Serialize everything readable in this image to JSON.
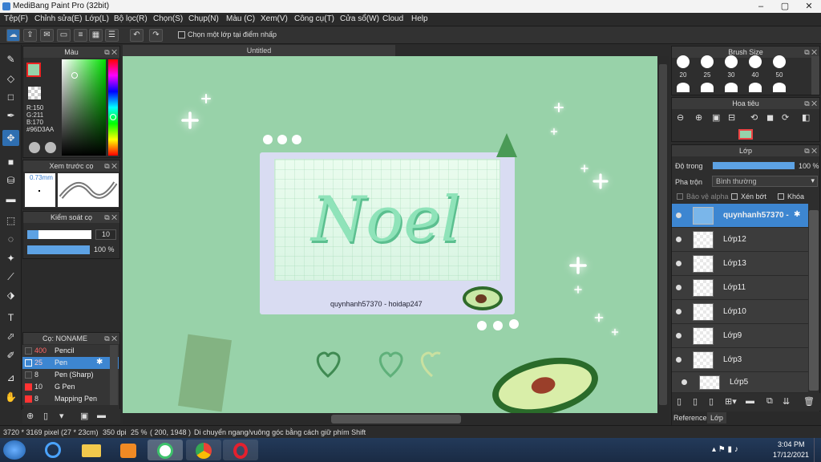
{
  "app": {
    "title": "MediBang Paint Pro (32bit)"
  },
  "menu": [
    "Tệp(F)",
    "Chỉnh sửa(E)",
    "Lớp(L)",
    "Bộ lọc(R)",
    "Chọn(S)",
    "Chụp(N)",
    "Màu (C)",
    "Xem(V)",
    "Công cụ(T)",
    "Cửa sổ(W)",
    "Cloud",
    "Help"
  ],
  "toolbar": {
    "select_checkbox_label": "Chọn một lớp tại điểm nhấp"
  },
  "color_panel": {
    "title": "Màu",
    "r": "R:150",
    "g": "G:211",
    "b": "B:170",
    "hex": "#96D3AA",
    "fg_color": "#96D3AA",
    "bg_color": "#ffffff"
  },
  "brush_preview": {
    "title": "Xem trước cọ",
    "size": "0.73mm"
  },
  "brush_control": {
    "title": "Kiểm soát cọ",
    "size_value": "10",
    "opacity_value": "100 %"
  },
  "brush_list": {
    "title": "Cọ: NONAME",
    "items": [
      {
        "size": "400",
        "name": "Pencil",
        "color": "#3a3a3a"
      },
      {
        "size": "25",
        "name": "Pen",
        "color": "#3d86d1"
      },
      {
        "size": "8",
        "name": "Pen (Sharp)",
        "color": "#3a3a3a"
      },
      {
        "size": "10",
        "name": "G Pen",
        "color": "#f03030"
      },
      {
        "size": "8",
        "name": "Mapping Pen",
        "color": "#f03030"
      }
    ]
  },
  "canvas": {
    "tab": "Untitled",
    "title_text": "Noel",
    "caption": "quynhanh57370 - hoidap247",
    "bg_color": "#98d2a9"
  },
  "brush_size_panel": {
    "title": "Brush Size",
    "sizes": [
      "20",
      "25",
      "30",
      "40",
      "50"
    ]
  },
  "navigator": {
    "title": "Hoa tiêu"
  },
  "layer_panel": {
    "title": "Lớp",
    "opacity_label": "Độ trong",
    "opacity_value": "100 %",
    "opacity_fraction": 1.0,
    "blend_label": "Pha trộn",
    "blend_value": "Bình thường",
    "protect_alpha": "Bảo vệ alpha",
    "clipping": "Xén bớt",
    "lock": "Khóa",
    "layers": [
      "quynhanh57370 -",
      "Lớp12",
      "Lớp13",
      "Lớp11",
      "Lớp10",
      "Lớp9",
      "Lớp3",
      "Lớp5"
    ],
    "tabs": [
      "Reference",
      "Lớp"
    ]
  },
  "status": {
    "pixel": "3720 * 3169 pixel",
    "cm": "(27 * 23cm)",
    "dpi": "350 dpi",
    "zoom": "25 %",
    "coords": "( 200, 1948 )",
    "hint": "Di chuyển ngang/vuông góc bằng cách giữ phím Shift"
  },
  "taskbar": {
    "time": "3:04 PM",
    "date": "17/12/2021"
  }
}
